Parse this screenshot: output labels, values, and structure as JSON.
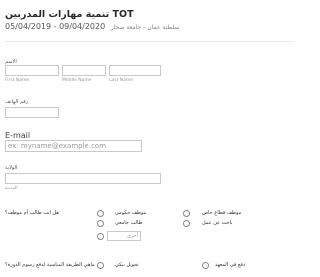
{
  "form": {
    "title": "تنمية مهارات المدربين TOT",
    "dates": "05/04/2019 - 09/04/2020",
    "location": "سلطنة عمان - جامعة صحار"
  },
  "name": {
    "label": "الاسم",
    "first": "First Name",
    "middle": "Middle Name",
    "last": "Last Name"
  },
  "phone": {
    "label": "رقم الهاتف"
  },
  "email": {
    "label": "E-mail",
    "placeholder": "ex: myname@example.com"
  },
  "state": {
    "label": "الولاية",
    "sub": "المدينة"
  },
  "employment": {
    "question": "هل انت طالب أم موظف؟",
    "options": [
      "موظف حكومي",
      "موظف قطاع خاص",
      "طالب جامعي",
      "باحث عن عمل",
      "أخرى"
    ]
  },
  "payment": {
    "question": "ماهي الطريقة المناسبة لدفع رسوم الدورة؟",
    "options": [
      "تحويل بنكي",
      "دفع في المعهد"
    ]
  }
}
